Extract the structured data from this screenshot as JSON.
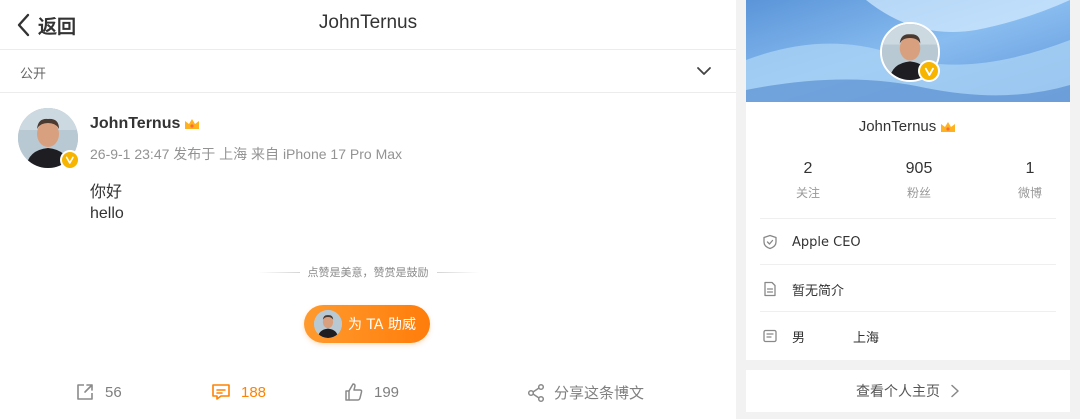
{
  "nav": {
    "back_label": "返回",
    "title": "JohnTernus"
  },
  "visibility": {
    "label": "公开"
  },
  "post": {
    "author": "JohnTernus",
    "meta": "26-9-1 23:47  发布于 上海  来自 iPhone 17 Pro Max",
    "lines": [
      "你好",
      "hello"
    ]
  },
  "reward": {
    "tip": "点赞是美意，赞赏是鼓励",
    "button_label": "为 TA 助威"
  },
  "actions": {
    "repost_count": "56",
    "comment_count": "188",
    "like_count": "199",
    "share_label": "分享这条博文"
  },
  "profile": {
    "name": "JohnTernus",
    "stats": [
      {
        "value": "2",
        "label": "关注"
      },
      {
        "value": "905",
        "label": "粉丝"
      },
      {
        "value": "1",
        "label": "微博"
      }
    ],
    "verified_title": "Apple CEO",
    "bio": "暂无简介",
    "gender": "男",
    "location": "上海",
    "homepage_label": "查看个人主页"
  },
  "colors": {
    "accent": "#ff8200",
    "verify_badge": "#f7b500",
    "cover_blue": "#6fa8e8"
  }
}
